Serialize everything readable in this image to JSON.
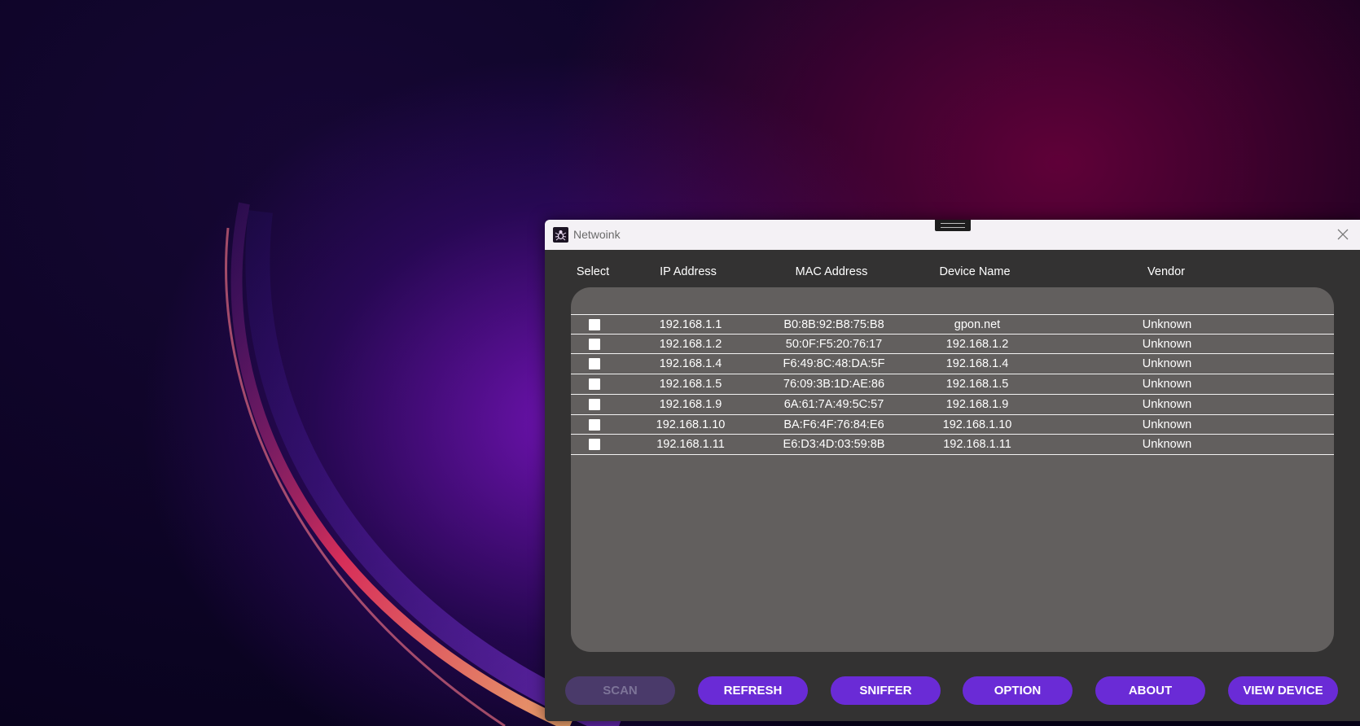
{
  "window": {
    "title": "Netwoink",
    "close_icon": "close-icon",
    "app_icon": "spider-icon"
  },
  "table": {
    "headers": {
      "select": "Select",
      "ip": "IP Address",
      "mac": "MAC Address",
      "device": "Device Name",
      "vendor": "Vendor"
    },
    "rows": [
      {
        "checked": false,
        "ip": "192.168.1.1",
        "mac": "B0:8B:92:B8:75:B8",
        "device": "gpon.net",
        "vendor": "Unknown"
      },
      {
        "checked": false,
        "ip": "192.168.1.2",
        "mac": "50:0F:F5:20:76:17",
        "device": "192.168.1.2",
        "vendor": "Unknown"
      },
      {
        "checked": false,
        "ip": "192.168.1.4",
        "mac": "F6:49:8C:48:DA:5F",
        "device": "192.168.1.4",
        "vendor": "Unknown"
      },
      {
        "checked": false,
        "ip": "192.168.1.5",
        "mac": "76:09:3B:1D:AE:86",
        "device": "192.168.1.5",
        "vendor": "Unknown"
      },
      {
        "checked": false,
        "ip": "192.168.1.9",
        "mac": "6A:61:7A:49:5C:57",
        "device": "192.168.1.9",
        "vendor": "Unknown"
      },
      {
        "checked": false,
        "ip": "192.168.1.10",
        "mac": "BA:F6:4F:76:84:E6",
        "device": "192.168.1.10",
        "vendor": "Unknown"
      },
      {
        "checked": false,
        "ip": "192.168.1.11",
        "mac": "E6:D3:4D:03:59:8B",
        "device": "192.168.1.11",
        "vendor": "Unknown"
      }
    ]
  },
  "buttons": {
    "scan": "SCAN",
    "refresh": "REFRESH",
    "sniffer": "SNIFFER",
    "option": "OPTION",
    "about": "ABOUT",
    "view_device": "VIEW DEVICE"
  },
  "colors": {
    "accent": "#6a2bd6",
    "disabled": "#4a3a6a",
    "panel": "#625f5e",
    "window_bg": "#333232"
  }
}
